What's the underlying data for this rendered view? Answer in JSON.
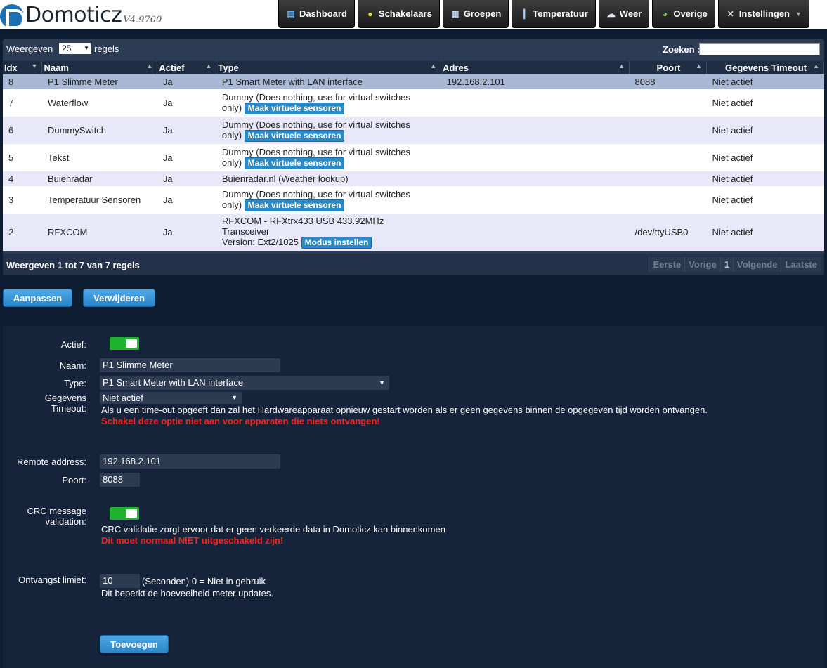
{
  "header": {
    "logo_text": "Domoticz",
    "version": "V4.9700",
    "nav": [
      {
        "label": "Dashboard",
        "icon": "dashboard-icon"
      },
      {
        "label": "Schakelaars",
        "icon": "lightbulb-icon"
      },
      {
        "label": "Groepen",
        "icon": "scene-icon"
      },
      {
        "label": "Temperatuur",
        "icon": "thermometer-icon"
      },
      {
        "label": "Weer",
        "icon": "weather-icon"
      },
      {
        "label": "Overige",
        "icon": "utility-icon"
      },
      {
        "label": "Instellingen",
        "icon": "tools-icon"
      }
    ]
  },
  "table": {
    "show_label": "Weergeven",
    "page_length": "25",
    "rows_label": "regels",
    "search_label": "Zoeken :",
    "search_value": "",
    "columns": [
      "Idx",
      "Naam",
      "Actief",
      "Type",
      "Adres",
      "Poort",
      "Gegevens Timeout"
    ],
    "rows": [
      {
        "idx": "8",
        "naam": "P1 Slimme Meter",
        "actief": "Ja",
        "type": "P1 Smart Meter with LAN interface",
        "type2": "",
        "action": "",
        "adres": "192.168.2.101",
        "poort": "8088",
        "timeout": "Niet actief"
      },
      {
        "idx": "7",
        "naam": "Waterflow",
        "actief": "Ja",
        "type": "Dummy (Does nothing, use for virtual switches",
        "type2": "only)",
        "action": "Maak virtuele sensoren",
        "adres": "",
        "poort": "",
        "timeout": "Niet actief"
      },
      {
        "idx": "6",
        "naam": "DummySwitch",
        "actief": "Ja",
        "type": "Dummy (Does nothing, use for virtual switches",
        "type2": "only)",
        "action": "Maak virtuele sensoren",
        "adres": "",
        "poort": "",
        "timeout": "Niet actief"
      },
      {
        "idx": "5",
        "naam": "Tekst",
        "actief": "Ja",
        "type": "Dummy (Does nothing, use for virtual switches",
        "type2": "only)",
        "action": "Maak virtuele sensoren",
        "adres": "",
        "poort": "",
        "timeout": "Niet actief"
      },
      {
        "idx": "4",
        "naam": "Buienradar",
        "actief": "Ja",
        "type": "Buienradar.nl (Weather lookup)",
        "type2": "",
        "action": "",
        "adres": "",
        "poort": "",
        "timeout": "Niet actief"
      },
      {
        "idx": "3",
        "naam": "Temperatuur Sensoren",
        "actief": "Ja",
        "type": "Dummy (Does nothing, use for virtual switches",
        "type2": "only)",
        "action": "Maak virtuele sensoren",
        "adres": "",
        "poort": "",
        "timeout": "Niet actief"
      },
      {
        "idx": "2",
        "naam": "RFXCOM",
        "actief": "Ja",
        "type": "RFXCOM - RFXtrx433 USB 433.92MHz",
        "type2": "Transceiver",
        "type3": "Version: Ext2/1025",
        "action": "Modus instellen",
        "adres": "",
        "poort": "/dev/ttyUSB0",
        "timeout": "Niet actief"
      }
    ],
    "info": "Weergeven 1 tot 7 van 7 regels",
    "pager": [
      "Eerste",
      "Vorige",
      "1",
      "Volgende",
      "Laatste"
    ]
  },
  "actions": {
    "edit": "Aanpassen",
    "delete": "Verwijderen"
  },
  "form": {
    "actief_label": "Actief:",
    "naam_label": "Naam:",
    "naam_value": "P1 Slimme Meter",
    "type_label": "Type:",
    "type_value": "P1 Smart Meter with LAN interface",
    "timeout_label_1": "Gegevens",
    "timeout_label_2": "Timeout:",
    "timeout_value": "Niet actief",
    "timeout_help": "Als u een time-out opgeeft dan zal het Hardwareapparaat opnieuw gestart worden als er geen gegevens binnen de opgegeven tijd worden ontvangen.",
    "timeout_warning": "Schakel deze optie niet aan voor apparaten die niets ontvangen!",
    "remote_label": "Remote address:",
    "remote_value": "192.168.2.101",
    "poort_label": "Poort:",
    "poort_value": "8088",
    "crc_label_1": "CRC message",
    "crc_label_2": "validation:",
    "crc_help": "CRC validatie zorgt ervoor dat er geen verkeerde data in Domoticz kan binnenkomen",
    "crc_warning": "Dit moet normaal NIET uitgeschakeld zijn!",
    "limiet_label": "Ontvangst limiet:",
    "limiet_value": "10",
    "limiet_unit": "(Seconden) 0 = Niet in gebruik",
    "limiet_help": "Dit beperkt de hoeveelheid meter updates.",
    "submit": "Toevoegen"
  }
}
